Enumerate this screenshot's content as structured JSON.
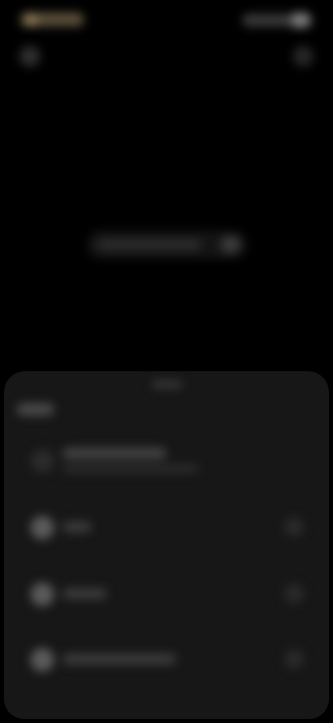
{
  "theme": {
    "background": "#000000",
    "sheet_background": "#171717",
    "accent_status": "#8d7b55"
  },
  "status_bar": {
    "time": "",
    "icons": [
      "signal-icon",
      "wifi-icon",
      "battery-icon"
    ]
  },
  "top_actions": {
    "left_icon": "back-icon",
    "right_icon": "menu-icon"
  },
  "center_pill": {
    "label": "",
    "icon": "chevron-icon"
  },
  "sheet": {
    "header": "",
    "rows": [
      {
        "icon": "item-icon",
        "label": "",
        "sublabel": "",
        "trailing_icon": ""
      },
      {
        "icon": "item-icon",
        "label": "",
        "trailing_icon": "chevron-icon"
      },
      {
        "icon": "item-icon",
        "label": "",
        "trailing_icon": "chevron-icon"
      },
      {
        "icon": "item-icon",
        "label": "",
        "trailing_icon": "chevron-icon"
      }
    ]
  }
}
